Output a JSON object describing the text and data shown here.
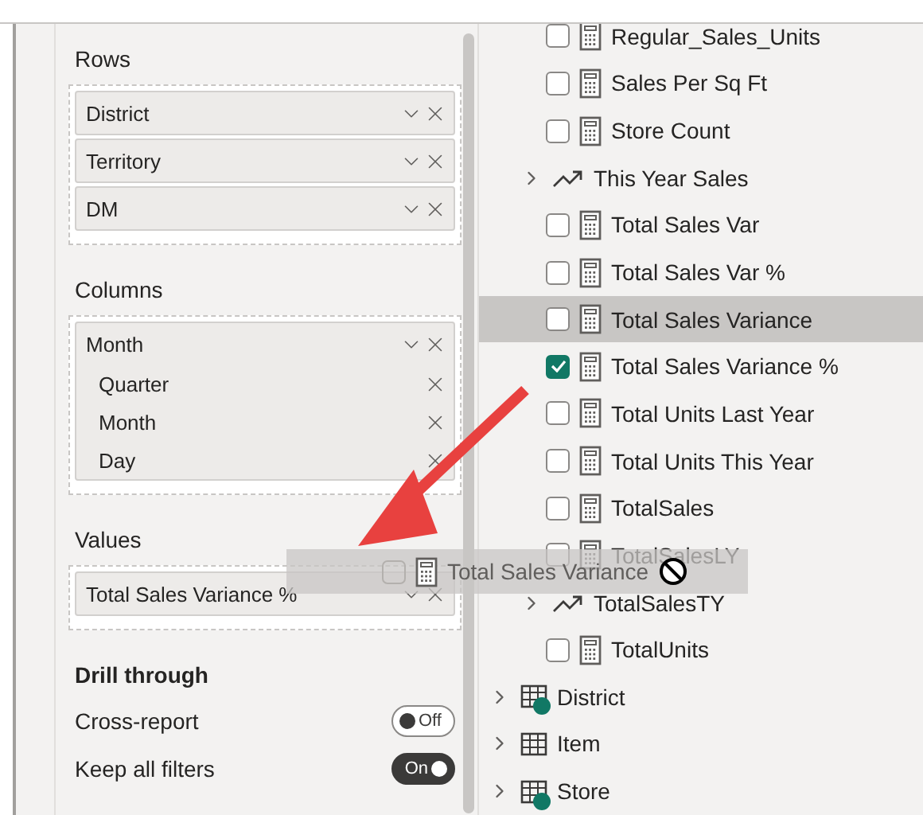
{
  "wells": [
    {
      "label": "Rows",
      "fields": [
        {
          "name": "District"
        },
        {
          "name": "Territory"
        },
        {
          "name": "DM"
        }
      ]
    },
    {
      "label": "Columns",
      "fields": [
        {
          "name": "Month",
          "children": [
            {
              "name": "Quarter"
            },
            {
              "name": "Month"
            },
            {
              "name": "Day"
            }
          ]
        }
      ]
    },
    {
      "label": "Values",
      "fields": [
        {
          "name": "Total Sales Variance %"
        }
      ]
    }
  ],
  "drill_through": {
    "title": "Drill through",
    "toggles": [
      {
        "label": "Cross-report",
        "on": false,
        "state_text": "Off"
      },
      {
        "label": "Keep all filters",
        "on": true,
        "state_text": "On"
      }
    ]
  },
  "fields": [
    {
      "kind": "measure",
      "name": "Regular_Sales_Units",
      "checked": false,
      "selected": false
    },
    {
      "kind": "measure",
      "name": "Sales Per Sq Ft",
      "checked": false,
      "selected": false
    },
    {
      "kind": "measure",
      "name": "Store Count",
      "checked": false,
      "selected": false
    },
    {
      "kind": "kpi",
      "name": "This Year Sales",
      "expanded": false
    },
    {
      "kind": "measure",
      "name": "Total Sales Var",
      "checked": false,
      "selected": false
    },
    {
      "kind": "measure",
      "name": "Total Sales Var %",
      "checked": false,
      "selected": false
    },
    {
      "kind": "measure",
      "name": "Total Sales Variance",
      "checked": false,
      "selected": true
    },
    {
      "kind": "measure",
      "name": "Total Sales Variance %",
      "checked": true,
      "selected": false
    },
    {
      "kind": "measure",
      "name": "Total Units Last Year",
      "checked": false,
      "selected": false
    },
    {
      "kind": "measure",
      "name": "Total Units This Year",
      "checked": false,
      "selected": false
    },
    {
      "kind": "measure",
      "name": "TotalSales",
      "checked": false,
      "selected": false
    },
    {
      "kind": "measure",
      "name": "TotalSalesLY",
      "checked": false,
      "selected": false
    },
    {
      "kind": "kpi",
      "name": "TotalSalesTY",
      "expanded": false
    },
    {
      "kind": "measure",
      "name": "TotalUnits",
      "checked": false,
      "selected": false
    },
    {
      "kind": "table",
      "name": "District",
      "expanded": false,
      "in_use": true
    },
    {
      "kind": "table",
      "name": "Item",
      "expanded": false,
      "in_use": false
    },
    {
      "kind": "table",
      "name": "Store",
      "expanded": false,
      "in_use": true
    }
  ],
  "drag_ghost": {
    "label": "Total Sales Variance"
  }
}
